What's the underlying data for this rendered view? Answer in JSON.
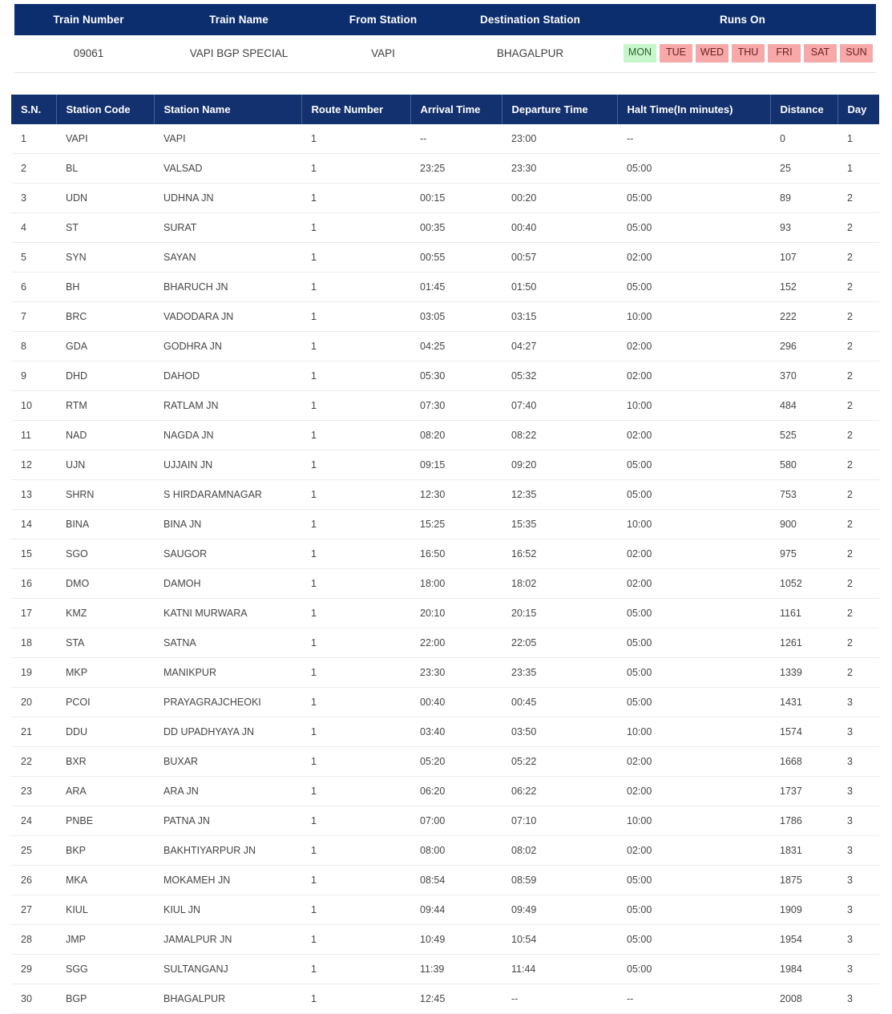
{
  "summary": {
    "headers": {
      "train_number": "Train Number",
      "train_name": "Train Name",
      "from_station": "From Station",
      "destination_station": "Destination Station",
      "runs_on": "Runs On"
    },
    "row": {
      "train_number": "09061",
      "train_name": "VAPI BGP SPECIAL",
      "from_station": "VAPI",
      "destination_station": "BHAGALPUR"
    },
    "days": [
      {
        "label": "MON",
        "active": true
      },
      {
        "label": "TUE",
        "active": false
      },
      {
        "label": "WED",
        "active": false
      },
      {
        "label": "THU",
        "active": false
      },
      {
        "label": "FRI",
        "active": false
      },
      {
        "label": "SAT",
        "active": false
      },
      {
        "label": "SUN",
        "active": false
      }
    ],
    "colors": {
      "header_blue": "#0d2e6e",
      "day_active_bg": "#c6f6c9",
      "day_active_text": "#2c5f2f",
      "day_inactive_bg": "#f7a8a8",
      "day_inactive_text": "#6b2020"
    }
  },
  "route_table": {
    "colors": {
      "header_blue": "#14316f",
      "row_border": "#ececec"
    },
    "columns": [
      "S.N.",
      "Station Code",
      "Station Name",
      "Route Number",
      "Arrival Time",
      "Departure Time",
      "Halt Time(In minutes)",
      "Distance",
      "Day"
    ],
    "rows": [
      [
        "1",
        "VAPI",
        "VAPI",
        "1",
        "--",
        "23:00",
        "--",
        "0",
        "1"
      ],
      [
        "2",
        "BL",
        "VALSAD",
        "1",
        "23:25",
        "23:30",
        "05:00",
        "25",
        "1"
      ],
      [
        "3",
        "UDN",
        "UDHNA JN",
        "1",
        "00:15",
        "00:20",
        "05:00",
        "89",
        "2"
      ],
      [
        "4",
        "ST",
        "SURAT",
        "1",
        "00:35",
        "00:40",
        "05:00",
        "93",
        "2"
      ],
      [
        "5",
        "SYN",
        "SAYAN",
        "1",
        "00:55",
        "00:57",
        "02:00",
        "107",
        "2"
      ],
      [
        "6",
        "BH",
        "BHARUCH JN",
        "1",
        "01:45",
        "01:50",
        "05:00",
        "152",
        "2"
      ],
      [
        "7",
        "BRC",
        "VADODARA JN",
        "1",
        "03:05",
        "03:15",
        "10:00",
        "222",
        "2"
      ],
      [
        "8",
        "GDA",
        "GODHRA JN",
        "1",
        "04:25",
        "04:27",
        "02:00",
        "296",
        "2"
      ],
      [
        "9",
        "DHD",
        "DAHOD",
        "1",
        "05:30",
        "05:32",
        "02:00",
        "370",
        "2"
      ],
      [
        "10",
        "RTM",
        "RATLAM JN",
        "1",
        "07:30",
        "07:40",
        "10:00",
        "484",
        "2"
      ],
      [
        "11",
        "NAD",
        "NAGDA JN",
        "1",
        "08:20",
        "08:22",
        "02:00",
        "525",
        "2"
      ],
      [
        "12",
        "UJN",
        "UJJAIN JN",
        "1",
        "09:15",
        "09:20",
        "05:00",
        "580",
        "2"
      ],
      [
        "13",
        "SHRN",
        "S HIRDARAMNAGAR",
        "1",
        "12:30",
        "12:35",
        "05:00",
        "753",
        "2"
      ],
      [
        "14",
        "BINA",
        "BINA JN",
        "1",
        "15:25",
        "15:35",
        "10:00",
        "900",
        "2"
      ],
      [
        "15",
        "SGO",
        "SAUGOR",
        "1",
        "16:50",
        "16:52",
        "02:00",
        "975",
        "2"
      ],
      [
        "16",
        "DMO",
        "DAMOH",
        "1",
        "18:00",
        "18:02",
        "02:00",
        "1052",
        "2"
      ],
      [
        "17",
        "KMZ",
        "KATNI MURWARA",
        "1",
        "20:10",
        "20:15",
        "05:00",
        "1161",
        "2"
      ],
      [
        "18",
        "STA",
        "SATNA",
        "1",
        "22:00",
        "22:05",
        "05:00",
        "1261",
        "2"
      ],
      [
        "19",
        "MKP",
        "MANIKPUR",
        "1",
        "23:30",
        "23:35",
        "05:00",
        "1339",
        "2"
      ],
      [
        "20",
        "PCOI",
        "PRAYAGRAJCHEOKI",
        "1",
        "00:40",
        "00:45",
        "05:00",
        "1431",
        "3"
      ],
      [
        "21",
        "DDU",
        "DD UPADHYAYA JN",
        "1",
        "03:40",
        "03:50",
        "10:00",
        "1574",
        "3"
      ],
      [
        "22",
        "BXR",
        "BUXAR",
        "1",
        "05:20",
        "05:22",
        "02:00",
        "1668",
        "3"
      ],
      [
        "23",
        "ARA",
        "ARA JN",
        "1",
        "06:20",
        "06:22",
        "02:00",
        "1737",
        "3"
      ],
      [
        "24",
        "PNBE",
        "PATNA JN",
        "1",
        "07:00",
        "07:10",
        "10:00",
        "1786",
        "3"
      ],
      [
        "25",
        "BKP",
        "BAKHTIYARPUR JN",
        "1",
        "08:00",
        "08:02",
        "02:00",
        "1831",
        "3"
      ],
      [
        "26",
        "MKA",
        "MOKAMEH JN",
        "1",
        "08:54",
        "08:59",
        "05:00",
        "1875",
        "3"
      ],
      [
        "27",
        "KIUL",
        "KIUL JN",
        "1",
        "09:44",
        "09:49",
        "05:00",
        "1909",
        "3"
      ],
      [
        "28",
        "JMP",
        "JAMALPUR JN",
        "1",
        "10:49",
        "10:54",
        "05:00",
        "1954",
        "3"
      ],
      [
        "29",
        "SGG",
        "SULTANGANJ",
        "1",
        "11:39",
        "11:44",
        "05:00",
        "1984",
        "3"
      ],
      [
        "30",
        "BGP",
        "BHAGALPUR",
        "1",
        "12:45",
        "--",
        "--",
        "2008",
        "3"
      ]
    ]
  }
}
